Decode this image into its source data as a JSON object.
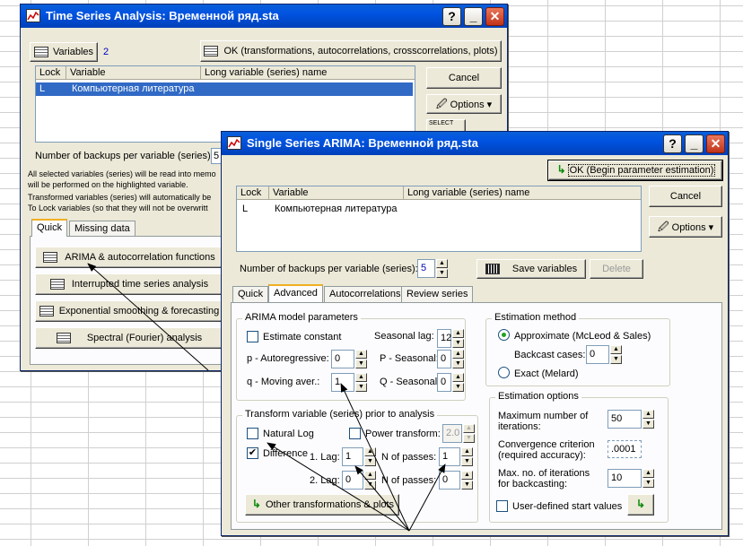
{
  "back_window": {
    "title": "Time Series Analysis: Временной ряд.sta",
    "variables_button": "Variables",
    "variables_count": "2",
    "ok_button": "OK (transformations, autocorrelations, crosscorrelations, plots)",
    "cancel_button": "Cancel",
    "options_button": "Options",
    "select_label": "SELECT",
    "columns": [
      "Lock",
      "Variable",
      "Long variable (series) name"
    ],
    "rows": [
      {
        "lock": "L",
        "variable": "Компьютерная литература"
      }
    ],
    "backups_label": "Number of backups per variable (series):",
    "backups_value": "5",
    "info_lines": [
      "All selected variables (series) will be read into memo",
      "will be performed on the highlighted variable.",
      "Transformed variables (series) will automatically be",
      "To Lock variables (so that they will not be overwritt"
    ],
    "tabs": [
      "Quick",
      "Missing data"
    ],
    "analysis_buttons": [
      "ARIMA & autocorrelation functions",
      "Interrupted time series analysis",
      "Exponential smoothing & forecasting",
      "Spectral (Fourier) analysis"
    ]
  },
  "front_window": {
    "title": "Single Series ARIMA: Временной ряд.sta",
    "ok_button": "OK (Begin parameter estimation)",
    "cancel_button": "Cancel",
    "options_button": "Options",
    "columns": [
      "Lock",
      "Variable",
      "Long variable (series) name"
    ],
    "rows": [
      {
        "lock": "L",
        "variable": "Компьютерная литература"
      }
    ],
    "backups_label": "Number of backups per variable (series):",
    "backups_value": "5",
    "save_variables": "Save variables",
    "delete_button": "Delete",
    "tabs": [
      "Quick",
      "Advanced",
      "Autocorrelations",
      "Review series"
    ],
    "arima_group": {
      "title": "ARIMA model parameters",
      "estimate_constant": "Estimate constant",
      "seasonal_lag_label": "Seasonal lag:",
      "seasonal_lag_value": "12",
      "p_label": "p - Autoregressive:",
      "p_value": "0",
      "P_label": "P - Seasonal:",
      "P_value": "0",
      "q_label": "q - Moving aver.:",
      "q_value": "1",
      "Q_label": "Q - Seasonal:",
      "Q_value": "0"
    },
    "transform_group": {
      "title": "Transform variable (series) prior to analysis",
      "natural_log": "Natural Log",
      "power_transform": "Power transform:",
      "power_value": "2.0",
      "difference": "Difference",
      "lag1_label": "1. Lag:",
      "lag1_value": "1",
      "passes1_label": "N of passes:",
      "passes1_value": "1",
      "lag2_label": "2. Lag:",
      "lag2_value": "0",
      "passes2_label": "N of passes:",
      "passes2_value": "0",
      "other_button": "Other transformations & plots"
    },
    "estimation_method": {
      "title": "Estimation method",
      "approximate": "Approximate (McLeod & Sales)",
      "backcast_label": "Backcast cases:",
      "backcast_value": "0",
      "exact": "Exact (Melard)"
    },
    "estimation_options": {
      "title": "Estimation options",
      "max_iter_label_1": "Maximum number of",
      "max_iter_label_2": "iterations:",
      "max_iter_value": "50",
      "conv_label_1": "Convergence criterion",
      "conv_label_2": "(required accuracy):",
      "conv_value": ".0001",
      "backcast_iter_label_1": "Max. no. of iterations",
      "backcast_iter_label_2": "for backcasting:",
      "backcast_iter_value": "10",
      "user_defined": "User-defined start values"
    }
  },
  "colors": {
    "titlebar": "#0053e1",
    "window_bg": "#ece9d8",
    "selection": "#316ac5"
  }
}
